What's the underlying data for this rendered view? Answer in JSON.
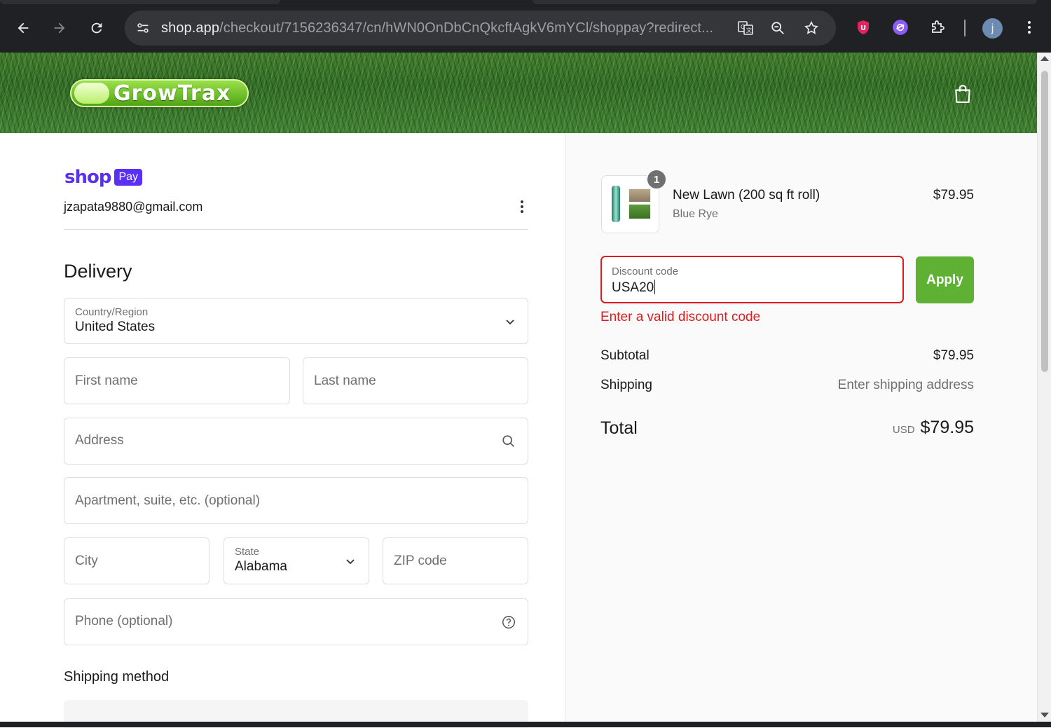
{
  "browser": {
    "url_host": "shop.app",
    "url_path": "/checkout/7156236347/cn/hWN0OnDbCnQkcftAgkV6mYCl/shoppay?redirect...",
    "profile_initial": "j"
  },
  "banner": {
    "logo_text": "GrowTrax"
  },
  "shop_pay": {
    "shop": "shop",
    "pay": "Pay",
    "email": "jzapata9880@gmail.com"
  },
  "delivery": {
    "heading": "Delivery",
    "country": {
      "label": "Country/Region",
      "value": "United States"
    },
    "first_name": {
      "placeholder": "First name"
    },
    "last_name": {
      "placeholder": "Last name"
    },
    "address": {
      "placeholder": "Address"
    },
    "apartment": {
      "placeholder": "Apartment, suite, etc. (optional)"
    },
    "city": {
      "placeholder": "City"
    },
    "state": {
      "label": "State",
      "value": "Alabama"
    },
    "zip": {
      "placeholder": "ZIP code"
    },
    "phone": {
      "placeholder": "Phone (optional)"
    }
  },
  "shipping_method": {
    "heading": "Shipping method"
  },
  "order": {
    "item": {
      "quantity": "1",
      "name": "New Lawn (200 sq ft roll)",
      "variant": "Blue Rye",
      "price": "$79.95"
    },
    "discount": {
      "label": "Discount code",
      "value": "USA20",
      "apply_label": "Apply",
      "error": "Enter a valid discount code"
    },
    "subtotal": {
      "label": "Subtotal",
      "value": "$79.95"
    },
    "shipping": {
      "label": "Shipping",
      "value": "Enter shipping address"
    },
    "total": {
      "label": "Total",
      "currency": "USD",
      "value": "$79.95"
    }
  },
  "colors": {
    "shop_pay_purple": "#5a31f4",
    "apply_green": "#5eb133",
    "error_red": "#dd1d1d"
  }
}
